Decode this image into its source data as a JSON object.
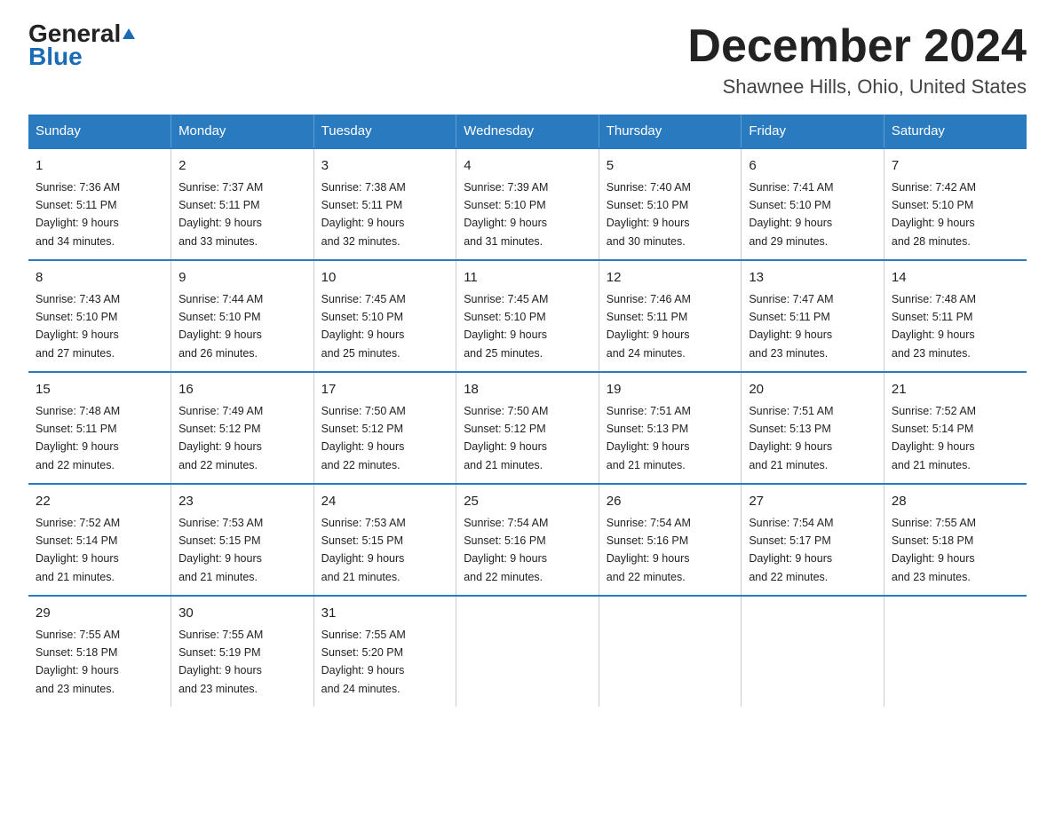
{
  "header": {
    "logo_general": "General",
    "logo_blue": "Blue",
    "title": "December 2024",
    "subtitle": "Shawnee Hills, Ohio, United States"
  },
  "days_of_week": [
    "Sunday",
    "Monday",
    "Tuesday",
    "Wednesday",
    "Thursday",
    "Friday",
    "Saturday"
  ],
  "weeks": [
    [
      {
        "day": 1,
        "sunrise": "7:36 AM",
        "sunset": "5:11 PM",
        "daylight": "9 hours and 34 minutes."
      },
      {
        "day": 2,
        "sunrise": "7:37 AM",
        "sunset": "5:11 PM",
        "daylight": "9 hours and 33 minutes."
      },
      {
        "day": 3,
        "sunrise": "7:38 AM",
        "sunset": "5:11 PM",
        "daylight": "9 hours and 32 minutes."
      },
      {
        "day": 4,
        "sunrise": "7:39 AM",
        "sunset": "5:10 PM",
        "daylight": "9 hours and 31 minutes."
      },
      {
        "day": 5,
        "sunrise": "7:40 AM",
        "sunset": "5:10 PM",
        "daylight": "9 hours and 30 minutes."
      },
      {
        "day": 6,
        "sunrise": "7:41 AM",
        "sunset": "5:10 PM",
        "daylight": "9 hours and 29 minutes."
      },
      {
        "day": 7,
        "sunrise": "7:42 AM",
        "sunset": "5:10 PM",
        "daylight": "9 hours and 28 minutes."
      }
    ],
    [
      {
        "day": 8,
        "sunrise": "7:43 AM",
        "sunset": "5:10 PM",
        "daylight": "9 hours and 27 minutes."
      },
      {
        "day": 9,
        "sunrise": "7:44 AM",
        "sunset": "5:10 PM",
        "daylight": "9 hours and 26 minutes."
      },
      {
        "day": 10,
        "sunrise": "7:45 AM",
        "sunset": "5:10 PM",
        "daylight": "9 hours and 25 minutes."
      },
      {
        "day": 11,
        "sunrise": "7:45 AM",
        "sunset": "5:10 PM",
        "daylight": "9 hours and 25 minutes."
      },
      {
        "day": 12,
        "sunrise": "7:46 AM",
        "sunset": "5:11 PM",
        "daylight": "9 hours and 24 minutes."
      },
      {
        "day": 13,
        "sunrise": "7:47 AM",
        "sunset": "5:11 PM",
        "daylight": "9 hours and 23 minutes."
      },
      {
        "day": 14,
        "sunrise": "7:48 AM",
        "sunset": "5:11 PM",
        "daylight": "9 hours and 23 minutes."
      }
    ],
    [
      {
        "day": 15,
        "sunrise": "7:48 AM",
        "sunset": "5:11 PM",
        "daylight": "9 hours and 22 minutes."
      },
      {
        "day": 16,
        "sunrise": "7:49 AM",
        "sunset": "5:12 PM",
        "daylight": "9 hours and 22 minutes."
      },
      {
        "day": 17,
        "sunrise": "7:50 AM",
        "sunset": "5:12 PM",
        "daylight": "9 hours and 22 minutes."
      },
      {
        "day": 18,
        "sunrise": "7:50 AM",
        "sunset": "5:12 PM",
        "daylight": "9 hours and 21 minutes."
      },
      {
        "day": 19,
        "sunrise": "7:51 AM",
        "sunset": "5:13 PM",
        "daylight": "9 hours and 21 minutes."
      },
      {
        "day": 20,
        "sunrise": "7:51 AM",
        "sunset": "5:13 PM",
        "daylight": "9 hours and 21 minutes."
      },
      {
        "day": 21,
        "sunrise": "7:52 AM",
        "sunset": "5:14 PM",
        "daylight": "9 hours and 21 minutes."
      }
    ],
    [
      {
        "day": 22,
        "sunrise": "7:52 AM",
        "sunset": "5:14 PM",
        "daylight": "9 hours and 21 minutes."
      },
      {
        "day": 23,
        "sunrise": "7:53 AM",
        "sunset": "5:15 PM",
        "daylight": "9 hours and 21 minutes."
      },
      {
        "day": 24,
        "sunrise": "7:53 AM",
        "sunset": "5:15 PM",
        "daylight": "9 hours and 21 minutes."
      },
      {
        "day": 25,
        "sunrise": "7:54 AM",
        "sunset": "5:16 PM",
        "daylight": "9 hours and 22 minutes."
      },
      {
        "day": 26,
        "sunrise": "7:54 AM",
        "sunset": "5:16 PM",
        "daylight": "9 hours and 22 minutes."
      },
      {
        "day": 27,
        "sunrise": "7:54 AM",
        "sunset": "5:17 PM",
        "daylight": "9 hours and 22 minutes."
      },
      {
        "day": 28,
        "sunrise": "7:55 AM",
        "sunset": "5:18 PM",
        "daylight": "9 hours and 23 minutes."
      }
    ],
    [
      {
        "day": 29,
        "sunrise": "7:55 AM",
        "sunset": "5:18 PM",
        "daylight": "9 hours and 23 minutes."
      },
      {
        "day": 30,
        "sunrise": "7:55 AM",
        "sunset": "5:19 PM",
        "daylight": "9 hours and 23 minutes."
      },
      {
        "day": 31,
        "sunrise": "7:55 AM",
        "sunset": "5:20 PM",
        "daylight": "9 hours and 24 minutes."
      },
      null,
      null,
      null,
      null
    ]
  ]
}
